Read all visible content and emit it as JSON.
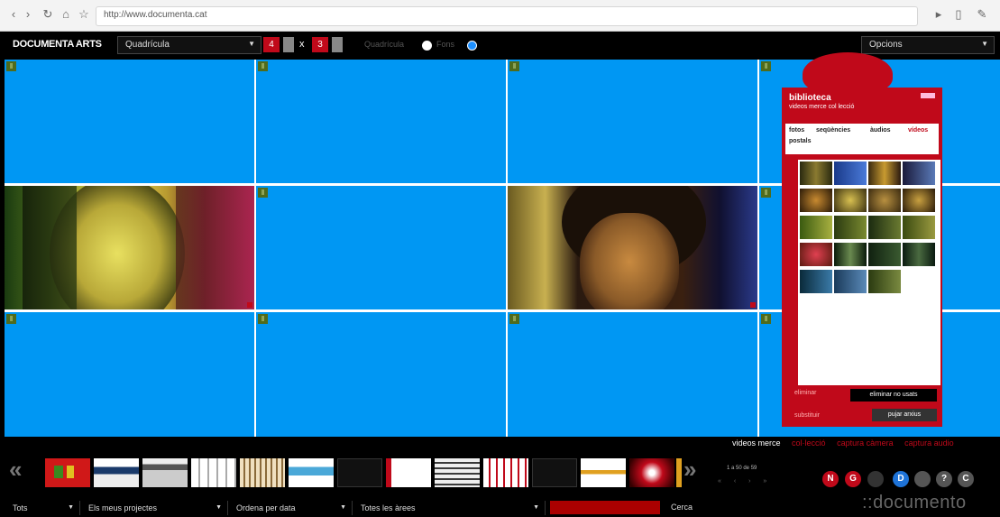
{
  "browser": {
    "url": "http://www.documenta.cat",
    "nav_icons": [
      "back-icon",
      "forward-icon",
      "reload-icon",
      "home-icon",
      "star-icon"
    ],
    "right_icons": [
      "play-icon",
      "page-icon",
      "wrench-icon"
    ]
  },
  "toolbar": {
    "brand": "DOCUMENTA ARTS",
    "layout_select": "Quadrícula",
    "rows_value": "4",
    "cols_value": "3",
    "times_sign": "x",
    "view_option_a": "Quadrícula",
    "view_option_b": "Fons",
    "options_select": "Opcions"
  },
  "library": {
    "title": "biblioteca",
    "subtitle": "videos merce col lecció",
    "tabs": [
      "fotos",
      "seqüències",
      "àudios",
      "vídeos",
      "postals"
    ],
    "active_tab": "vídeos",
    "delete_all": "eliminar",
    "delete_unused": "eliminar no usats",
    "replace": "substituir",
    "upload": "pujar arxius"
  },
  "bottom": {
    "media_tabs": [
      "videos merce",
      "col·lecció",
      "captura càmera",
      "captura audio"
    ],
    "page_info": "1 a 50 de 59",
    "page_dots": "« ‹ › »",
    "circle_buttons": [
      {
        "label": "N",
        "color": "#c0091a"
      },
      {
        "label": "G",
        "color": "#c0091a"
      },
      {
        "label": "",
        "color": "#333333"
      },
      {
        "label": "D",
        "color": "#1e73d8"
      },
      {
        "label": "",
        "color": "#555555"
      },
      {
        "label": "?",
        "color": "#555555"
      },
      {
        "label": "C",
        "color": "#555555"
      }
    ],
    "brand_footer": "::documento"
  },
  "footer": {
    "filter_all": "Tots",
    "my_projects": "Els meus projectes",
    "order": "Ordena per data",
    "areas": "Totes les àrees",
    "search_button": "Cerca"
  },
  "colors": {
    "accent_red": "#c0091a",
    "cell_blue": "#0097f3",
    "toolbar_black": "#000000"
  }
}
